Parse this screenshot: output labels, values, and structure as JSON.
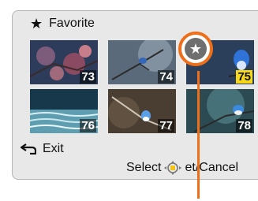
{
  "header": {
    "star_icon": "star-icon",
    "title": "Favorite"
  },
  "thumbnails": [
    {
      "number": "73",
      "selected": false
    },
    {
      "number": "74",
      "selected": false
    },
    {
      "number": "75",
      "selected": true
    },
    {
      "number": "76",
      "selected": false
    },
    {
      "number": "77",
      "selected": false
    },
    {
      "number": "78",
      "selected": false
    }
  ],
  "footer": {
    "exit_label": "Exit",
    "select_label": "Select",
    "set_cancel_label": "et/Cancel",
    "joystick_icon": "joystick-icon",
    "back_icon": "back-arrow-icon"
  },
  "overlay": {
    "favorite_badge_icon": "star-icon"
  },
  "colors": {
    "accent": "#ee6f1a",
    "screen_bg": "#e8e8e8",
    "selected_badge": "#f5d81d"
  }
}
